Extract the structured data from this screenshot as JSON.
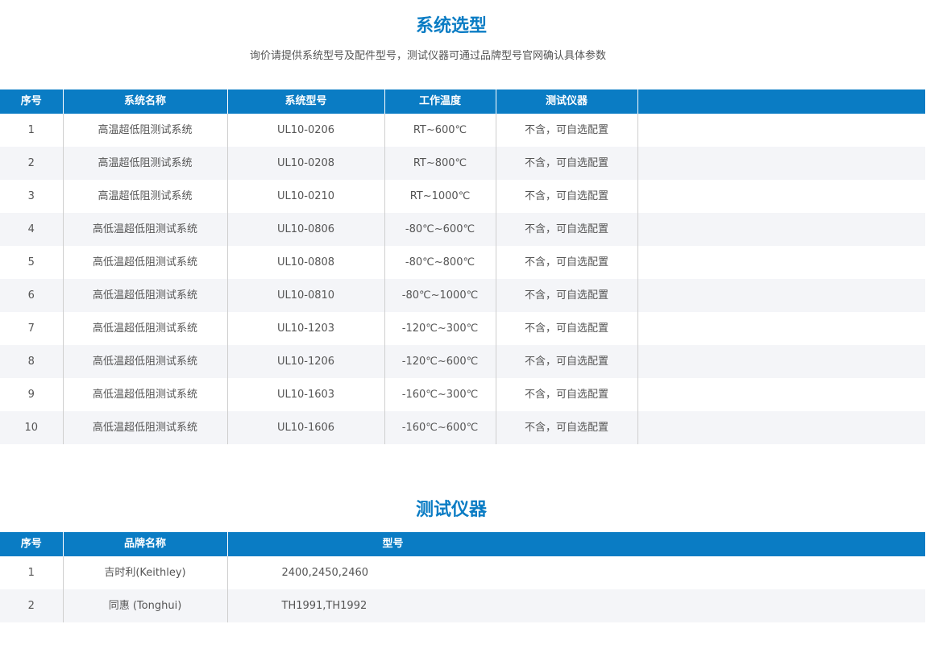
{
  "systems": {
    "title": "系统选型",
    "subtitle": "询价请提供系统型号及配件型号，测试仪器可通过品牌型号官网确认具体参数",
    "headers": {
      "index": "序号",
      "name": "系统名称",
      "model": "系统型号",
      "temp": "工作温度",
      "instrument": "测试仪器"
    },
    "rows": [
      {
        "index": "1",
        "name": "高温超低阻测试系统",
        "model": "UL10-0206",
        "temp": "RT~600℃",
        "instrument": "不含，可自选配置"
      },
      {
        "index": "2",
        "name": "高温超低阻测试系统",
        "model": "UL10-0208",
        "temp": "RT~800℃",
        "instrument": "不含，可自选配置"
      },
      {
        "index": "3",
        "name": "高温超低阻测试系统",
        "model": "UL10-0210",
        "temp": "RT~1000℃",
        "instrument": "不含，可自选配置"
      },
      {
        "index": "4",
        "name": "高低温超低阻测试系统",
        "model": "UL10-0806",
        "temp": "-80℃~600℃",
        "instrument": "不含，可自选配置"
      },
      {
        "index": "5",
        "name": "高低温超低阻测试系统",
        "model": "UL10-0808",
        "temp": "-80℃~800℃",
        "instrument": "不含，可自选配置"
      },
      {
        "index": "6",
        "name": "高低温超低阻测试系统",
        "model": "UL10-0810",
        "temp": "-80℃~1000℃",
        "instrument": "不含，可自选配置"
      },
      {
        "index": "7",
        "name": "高低温超低阻测试系统",
        "model": "UL10-1203",
        "temp": "-120℃~300℃",
        "instrument": "不含，可自选配置"
      },
      {
        "index": "8",
        "name": "高低温超低阻测试系统",
        "model": "UL10-1206",
        "temp": "-120℃~600℃",
        "instrument": "不含，可自选配置"
      },
      {
        "index": "9",
        "name": "高低温超低阻测试系统",
        "model": "UL10-1603",
        "temp": "-160℃~300℃",
        "instrument": "不含，可自选配置"
      },
      {
        "index": "10",
        "name": "高低温超低阻测试系统",
        "model": "UL10-1606",
        "temp": "-160℃~600℃",
        "instrument": "不含，可自选配置"
      }
    ]
  },
  "instruments": {
    "title": "测试仪器",
    "headers": {
      "index": "序号",
      "brand": "品牌名称",
      "model": "型号"
    },
    "rows": [
      {
        "index": "1",
        "brand": "吉时利(Keithley)",
        "model": "2400,2450,2460"
      },
      {
        "index": "2",
        "brand": "同惠 (Tonghui)",
        "model": "TH1991,TH1992"
      }
    ]
  },
  "colors": {
    "accent": "#0a7cc4",
    "stripe": "#f4f5f8",
    "text": "#555555"
  }
}
